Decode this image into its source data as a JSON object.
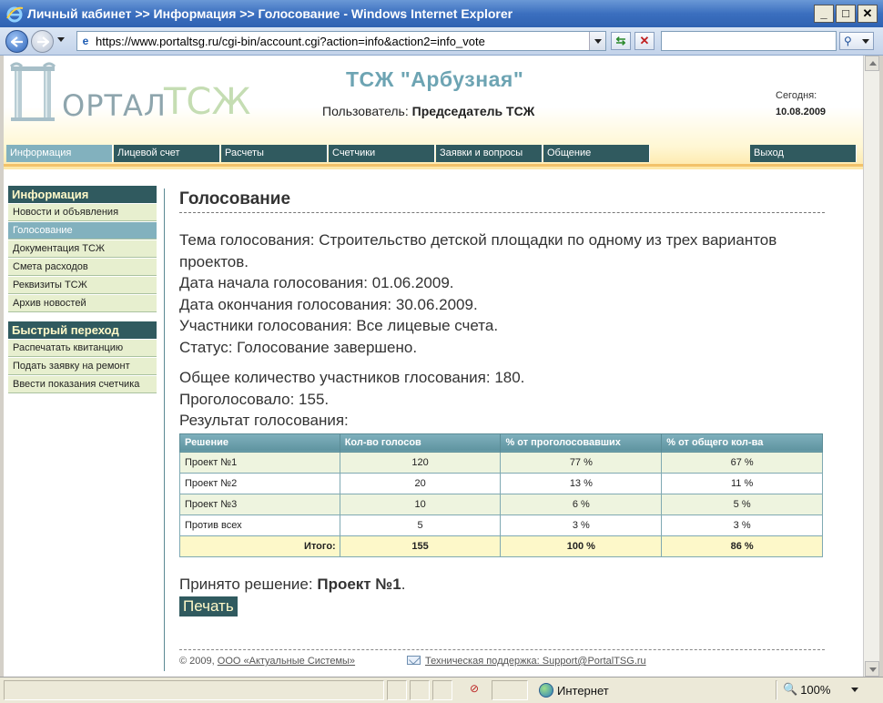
{
  "window": {
    "title": "Личный кабинет >> Информация >> Голосование - Windows Internet Explorer",
    "url": "https://www.portaltsg.ru/cgi-bin/account.cgi?action=info&action2=info_vote"
  },
  "header": {
    "logo_letter": "П",
    "logo_word1": "ОРТАЛ",
    "logo_word2": "ТСЖ",
    "org_name": "ТСЖ \"Арбузная\"",
    "user_label": "Пользователь:",
    "user_name": "Председатель ТСЖ",
    "today_label": "Сегодня:",
    "today_value": "10.08.2009"
  },
  "top_menu": {
    "items": [
      "Информация",
      "Лицевой счет",
      "Расчеты",
      "Счетчики",
      "Заявки и вопросы",
      "Общение"
    ],
    "logout": "Выход",
    "active": "Информация"
  },
  "left_nav": {
    "info_head": "Информация",
    "info_items": [
      "Новости и объявления",
      "Голосование",
      "Документация ТСЖ",
      "Смета расходов",
      "Реквизиты ТСЖ",
      "Архив новостей"
    ],
    "active": "Голосование",
    "quick_head": "Быстрый переход",
    "quick_items": [
      "Распечатать квитанцию",
      "Подать заявку на ремонт",
      "Ввести показания счетчика"
    ]
  },
  "vote": {
    "page_title": "Голосование",
    "topic": "Тема голосования: Строительство детской площадки по одному из трех вариантов проектов.",
    "start": "Дата начала голосования: 01.06.2009.",
    "end": "Дата окончания голосования: 30.06.2009.",
    "participants": "Участники голосования: Все лицевые счета.",
    "status": "Статус: Голосование завершено.",
    "total_participants": "Общее количество участников глосования: 180.",
    "voted": "Проголосовало: 155.",
    "result_label": "Результат голосования:",
    "table": {
      "headers": [
        "Решение",
        "Кол-во голосов",
        "% от проголосовавших",
        "% от общего кол-ва"
      ],
      "rows": [
        [
          "Проект №1",
          "120",
          "77 %",
          "67 %"
        ],
        [
          "Проект №2",
          "20",
          "13 %",
          "11 %"
        ],
        [
          "Проект №3",
          "10",
          "6 %",
          "5 %"
        ],
        [
          "Против всех",
          "5",
          "3 %",
          "3 %"
        ]
      ],
      "total": [
        "Итого:",
        "155",
        "100 %",
        "86 %"
      ]
    },
    "decision_label": "Принято решение:",
    "decision_value": "Проект №1",
    "decision_end": ".",
    "print_button": "Печать"
  },
  "footer": {
    "copyright": "© 2009,",
    "company": "ООО «Актуальные Системы»",
    "support": "Техническая поддержка: Support@PortalTSG.ru"
  },
  "status_bar": {
    "zone": "Интернет",
    "zoom": "100%"
  },
  "colors": {
    "accent_dark": "#305a5f",
    "accent_light": "#82b1be",
    "nav_bg": "#e7efcf"
  }
}
